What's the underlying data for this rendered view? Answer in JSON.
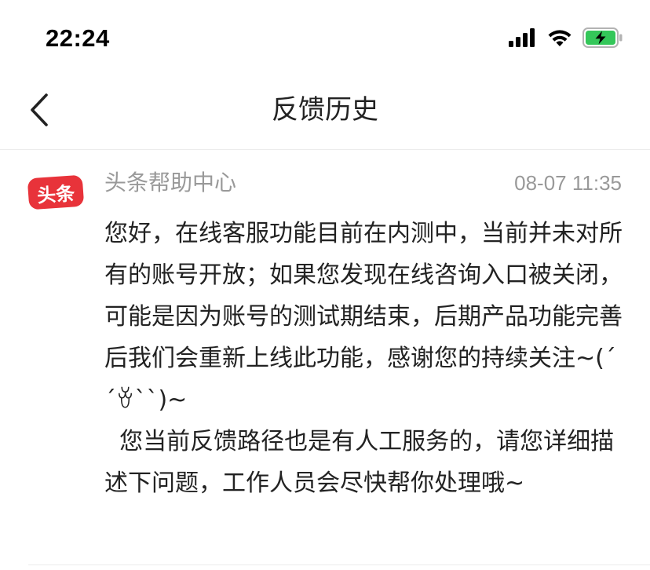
{
  "status_bar": {
    "time": "22:24",
    "signal_icon": "cellular-signal-icon",
    "wifi_icon": "wifi-icon",
    "battery_icon": "battery-charging-icon",
    "battery_color": "#34c759"
  },
  "nav": {
    "back_icon": "chevron-left-icon",
    "title": "反馈历史"
  },
  "message": {
    "avatar_text": "头条",
    "avatar_color": "#e8333a",
    "sender": "头条帮助中心",
    "timestamp": "08-07 11:35",
    "body": "您好，在线客服功能目前在内测中，当前并未对所有的账号开放；如果您发现在线咨询入口被关闭，可能是因为账号的测试期结束，后期产品功能完善后我们会重新上线此功能，感谢您的持续关注~(ˊˊꈊˋˋ)~\n  您当前反馈路径也是有人工服务的，请您详细描述下问题，工作人员会尽快帮你处理哦~"
  }
}
